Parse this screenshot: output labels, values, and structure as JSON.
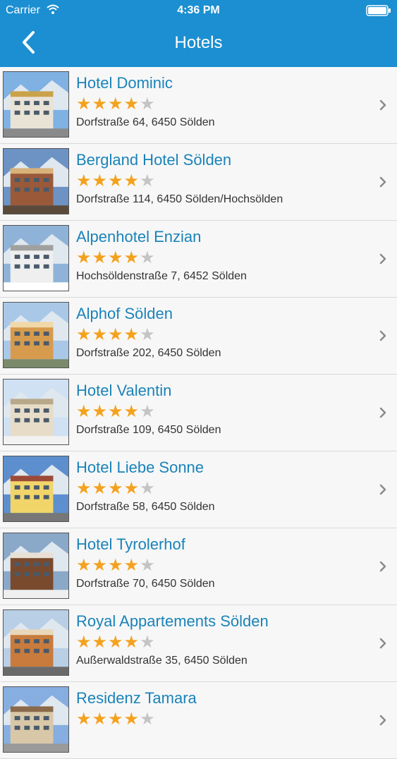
{
  "status_bar": {
    "carrier": "Carrier",
    "time": "4:36 PM",
    "wifi_icon": "wifi-icon",
    "battery_icon": "battery-icon"
  },
  "nav": {
    "title": "Hotels",
    "back_icon": "chevron-left-icon"
  },
  "colors": {
    "header": "#1b8fd1",
    "hotel_name": "#1a83b9",
    "star_on": "#f4a21e",
    "star_off": "#c4c4c4"
  },
  "hotels": [
    {
      "name": "Hotel Dominic",
      "rating": 4,
      "max_rating": 5,
      "address": "Dorfstraße 64, 6450 Sölden"
    },
    {
      "name": "Bergland Hotel Sölden",
      "rating": 4,
      "max_rating": 5,
      "address": "Dorfstraße 114, 6450 Sölden/Hochsölden"
    },
    {
      "name": "Alpenhotel Enzian",
      "rating": 4,
      "max_rating": 5,
      "address": "Hochsöldenstraße 7, 6452 Sölden"
    },
    {
      "name": "Alphof Sölden",
      "rating": 4,
      "max_rating": 5,
      "address": "Dorfstraße 202, 6450 Sölden"
    },
    {
      "name": "Hotel Valentin",
      "rating": 4,
      "max_rating": 5,
      "address": "Dorfstraße 109, 6450 Sölden"
    },
    {
      "name": "Hotel Liebe Sonne",
      "rating": 4,
      "max_rating": 5,
      "address": "Dorfstraße 58, 6450 Sölden"
    },
    {
      "name": "Hotel Tyrolerhof",
      "rating": 4,
      "max_rating": 5,
      "address": "Dorfstraße 70, 6450 Sölden"
    },
    {
      "name": "Royal Appartements Sölden",
      "rating": 4,
      "max_rating": 5,
      "address": "Außerwaldstraße 35, 6450 Sölden"
    },
    {
      "name": "Residenz Tamara",
      "rating": 4,
      "max_rating": 5,
      "address": ""
    }
  ]
}
